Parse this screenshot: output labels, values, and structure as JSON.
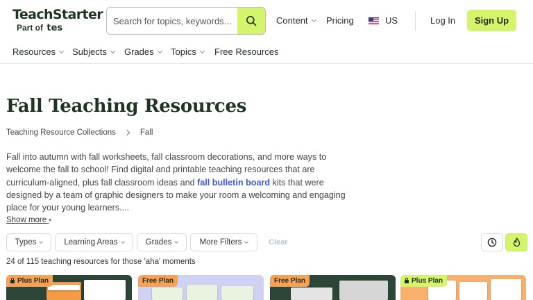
{
  "header": {
    "logo_main": "TeachStarter",
    "logo_sub": "Part of",
    "logo_sub_brand": "tes",
    "search_placeholder": "Search for topics, keywords...",
    "nav": {
      "content": "Content",
      "pricing": "Pricing",
      "region": "US"
    },
    "login": "Log In",
    "signup": "Sign Up"
  },
  "subnav": [
    "Resources",
    "Subjects",
    "Grades",
    "Topics",
    "Free Resources"
  ],
  "page": {
    "title": "Fall Teaching Resources",
    "breadcrumb": {
      "parent": "Teaching Resource Collections",
      "current": "Fall"
    },
    "description_before": "Fall into autumn with fall worksheets, fall classroom decorations, and more ways to welcome the fall to school! Find digital and printable teaching resources that are curriculum-aligned, plus fall classroom ideas and ",
    "description_link": "fall bulletin board",
    "description_after": " kits that were designed by a team of graphic designers to make your room a welcoming and engaging place for your young learners....",
    "show_more": "Show more"
  },
  "filters": {
    "types": "Types",
    "learning_areas": "Learning Areas",
    "grades": "Grades",
    "more": "More Filters",
    "clear": "Clear"
  },
  "results_count": "24 of 115 teaching resources for those 'aha' moments",
  "cards": [
    {
      "badge": "Plus Plan",
      "locked": true
    },
    {
      "badge": "Free Plan",
      "locked": false
    },
    {
      "badge": "Free Plan",
      "locked": false
    },
    {
      "badge": "Plus Plan",
      "locked": true
    }
  ],
  "colors": {
    "accent": "#d4f56b",
    "link": "#3a5bd0",
    "badge_orange": "#f5a256",
    "title": "#1f3524"
  }
}
